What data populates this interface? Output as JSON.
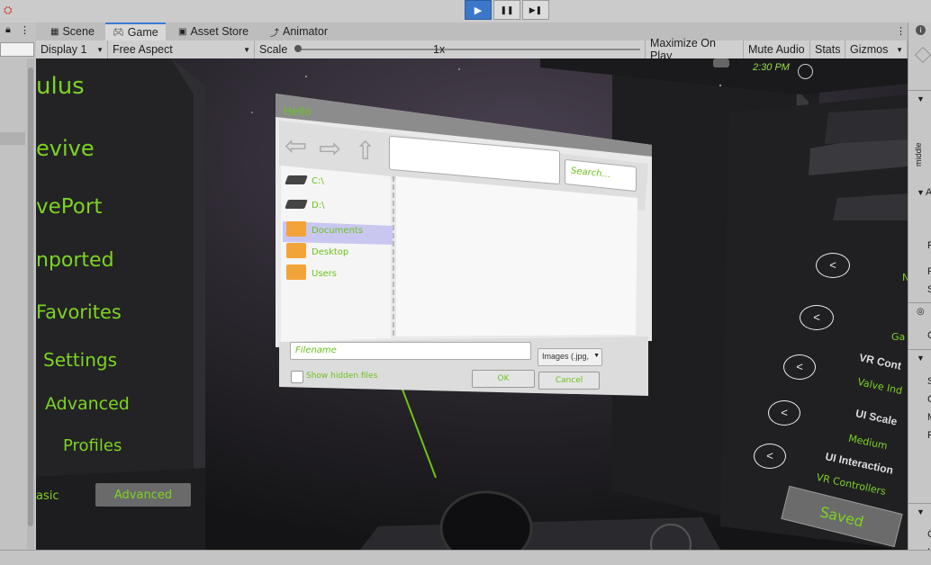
{
  "toolbar": {
    "play": "▶",
    "pause": "❚❚",
    "step": "▶❚"
  },
  "tabs": [
    {
      "label": "Scene",
      "icon": "scene-icon"
    },
    {
      "label": "Game",
      "icon": "gamepad-icon",
      "active": true
    },
    {
      "label": "Asset Store",
      "icon": "shopping-bag-icon"
    },
    {
      "label": "Animator",
      "icon": "animator-icon"
    }
  ],
  "game_bar": {
    "display": "Display 1",
    "aspect": "Free Aspect",
    "scale_label": "Scale",
    "scale_value": "1x",
    "maximize": "Maximize On Play",
    "mute": "Mute Audio",
    "stats": "Stats",
    "gizmos": "Gizmos"
  },
  "game": {
    "left_menu": [
      "ulus",
      "evive",
      "vePort",
      "nported",
      "Favorites",
      "Settings",
      "Advanced",
      "Profiles"
    ],
    "mode_basic": "asic",
    "mode_advanced": "Advanced",
    "clock": "2:30 PM",
    "dialog": {
      "title": "Hello",
      "search_placeholder": "Search...",
      "drives": [
        "C:\\",
        "D:\\"
      ],
      "folders": [
        "Documents",
        "Desktop",
        "Users"
      ],
      "filename_placeholder": "Filename",
      "filter": "Images (.jpg,",
      "show_hidden": "Show hidden files",
      "ok": "OK",
      "cancel": "Cancel"
    },
    "right_panel": {
      "ga": "Ga",
      "vr_controls": "VR Cont",
      "valve_ind": "Valve Ind",
      "ui_scale": "UI Scale",
      "medium": "Medium",
      "ui_interaction": "UI Interaction",
      "vr_controllers": "VR Controllers",
      "saved": "Saved",
      "n": "N"
    }
  },
  "inspector": {
    "middle": "middle",
    "letters": [
      "A",
      "P",
      "P",
      "S",
      "C",
      "S",
      "C",
      "M",
      "P",
      "C",
      "H"
    ]
  },
  "colors": {
    "accent": "#7dd321",
    "play_active": "#3b78c9"
  }
}
